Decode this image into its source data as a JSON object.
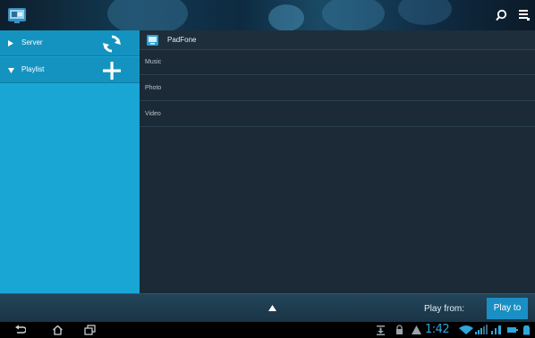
{
  "header": {
    "app_icon": "media-share-logo-icon",
    "actions": [
      "search-icon",
      "overflow-menu-icon"
    ]
  },
  "sidebar": {
    "items": [
      {
        "label": "Server",
        "expanded": false,
        "action_icon": "refresh-icon"
      },
      {
        "label": "Playlist",
        "expanded": true,
        "action_icon": "add-icon"
      }
    ]
  },
  "main": {
    "device_icon": "device-icon",
    "device_name": "PadFone",
    "categories": [
      "Music",
      "Photo",
      "Video"
    ]
  },
  "playbar": {
    "expand_icon": "up-arrow-icon",
    "play_from_label": "Play from:",
    "play_to_label": "Play to"
  },
  "system_bar": {
    "nav_icons": [
      "back-icon",
      "home-icon",
      "recent-apps-icon"
    ],
    "status_icons": [
      "download-icon",
      "lock-icon",
      "warning-icon"
    ],
    "clock": "1:42",
    "colors": {
      "accent": "#2fa7db",
      "sidebar": "#19a6d5",
      "main_bg": "#1b2a36"
    }
  }
}
